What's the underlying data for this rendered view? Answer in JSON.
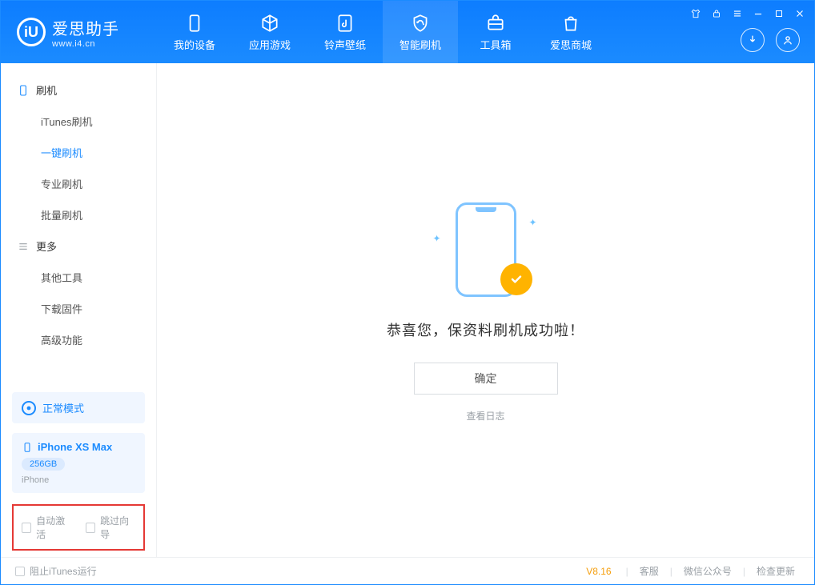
{
  "app": {
    "name": "爱思助手",
    "site": "www.i4.cn"
  },
  "nav": {
    "tabs": [
      {
        "label": "我的设备"
      },
      {
        "label": "应用游戏"
      },
      {
        "label": "铃声壁纸"
      },
      {
        "label": "智能刷机"
      },
      {
        "label": "工具箱"
      },
      {
        "label": "爱思商城"
      }
    ]
  },
  "sidebar": {
    "group1": {
      "title": "刷机",
      "items": [
        "iTunes刷机",
        "一键刷机",
        "专业刷机",
        "批量刷机"
      ],
      "active_index": 1
    },
    "group2": {
      "title": "更多",
      "items": [
        "其他工具",
        "下载固件",
        "高级功能"
      ]
    },
    "mode": {
      "label": "正常模式"
    },
    "device": {
      "name": "iPhone XS Max",
      "capacity": "256GB",
      "type": "iPhone"
    },
    "options": {
      "auto_activate": "自动激活",
      "skip_guide": "跳过向导"
    }
  },
  "main": {
    "success_title": "恭喜您，保资料刷机成功啦！",
    "ok_label": "确定",
    "view_log": "查看日志"
  },
  "status": {
    "block_itunes": "阻止iTunes运行",
    "version": "V8.16",
    "links": [
      "客服",
      "微信公众号",
      "检查更新"
    ]
  }
}
